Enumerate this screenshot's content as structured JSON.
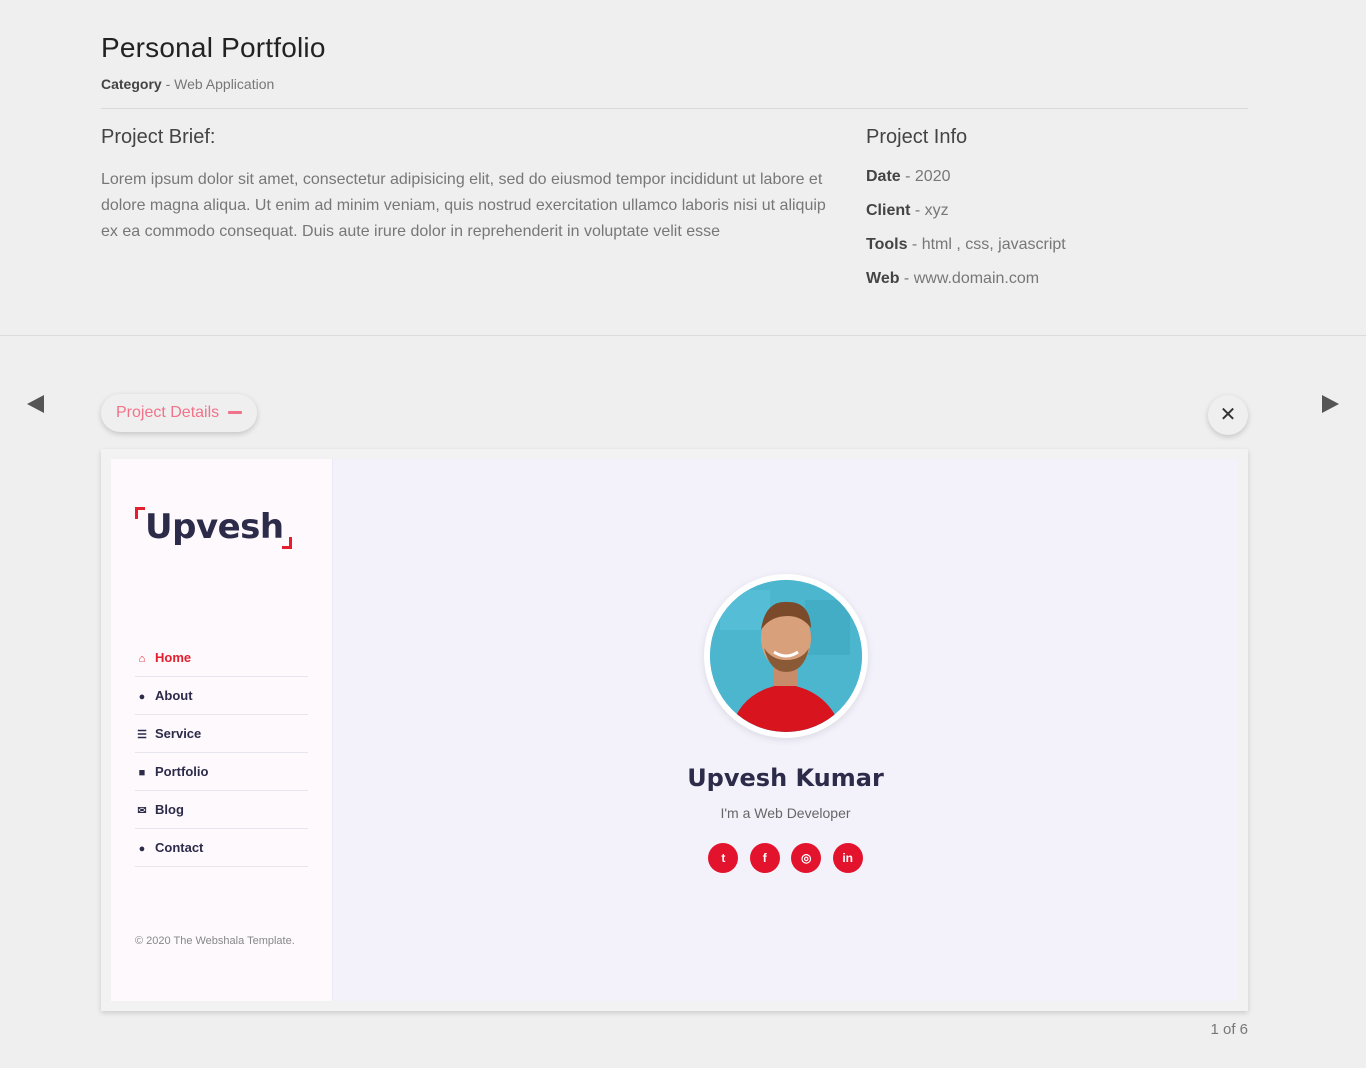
{
  "project": {
    "title": "Personal Portfolio",
    "category_label": "Category",
    "category_separator": " - ",
    "category_value": "Web Application"
  },
  "brief": {
    "heading": "Project Brief:",
    "text": "Lorem ipsum dolor sit amet, consectetur adipisicing elit, sed do eiusmod tempor incididunt ut labore et dolore magna aliqua. Ut enim ad minim veniam, quis nostrud exercitation ullamco laboris nisi ut aliquip ex ea commodo consequat. Duis aute irure dolor in reprehenderit in voluptate velit esse"
  },
  "info": {
    "heading": "Project Info",
    "items": [
      {
        "label": "Date",
        "value": " - 2020"
      },
      {
        "label": "Client",
        "value": " - xyz"
      },
      {
        "label": "Tools",
        "value": " - html , css, javascript"
      },
      {
        "label": "Web",
        "value": " - www.domain.com"
      }
    ]
  },
  "controls": {
    "details_label": "Project Details",
    "close_symbol": "✕",
    "counter": "1 of 6"
  },
  "preview": {
    "logo": "Upvesh",
    "nav": [
      {
        "label": "Home",
        "icon": "home-icon",
        "glyph": "⌂"
      },
      {
        "label": "About",
        "icon": "user-icon",
        "glyph": "●"
      },
      {
        "label": "Service",
        "icon": "list-icon",
        "glyph": "☰"
      },
      {
        "label": "Portfolio",
        "icon": "briefcase-icon",
        "glyph": "■"
      },
      {
        "label": "Blog",
        "icon": "envelope-icon",
        "glyph": "✉"
      },
      {
        "label": "Contact",
        "icon": "comments-icon",
        "glyph": "●"
      }
    ],
    "copyright": "© 2020 The Webshala Template.",
    "name": "Upvesh Kumar",
    "role": "I'm a Web Developer",
    "socials": [
      {
        "name": "twitter-icon",
        "glyph": "t"
      },
      {
        "name": "facebook-icon",
        "glyph": "f"
      },
      {
        "name": "instagram-icon",
        "glyph": "◎"
      },
      {
        "name": "linkedin-icon",
        "glyph": "in"
      }
    ]
  },
  "colors": {
    "accent_pink": "#f0738a",
    "brand_red": "#e4202f",
    "dark_navy": "#2c2b49"
  }
}
